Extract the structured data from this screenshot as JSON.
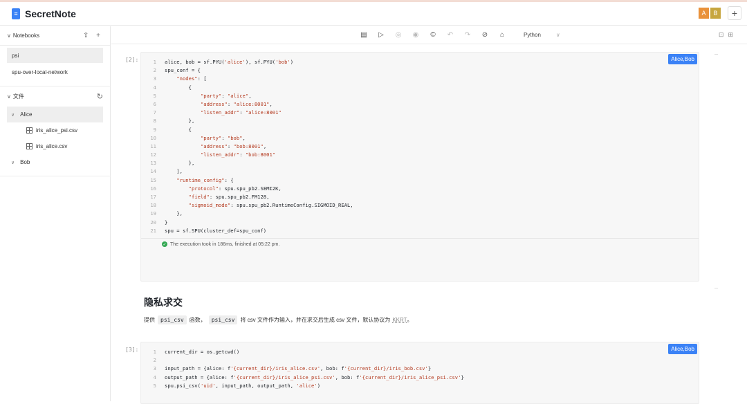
{
  "app": {
    "title": "SecretNote",
    "logo_icon": "notebook-icon"
  },
  "header": {
    "avatars": [
      "A",
      "B"
    ],
    "add_label": "+"
  },
  "sidebar": {
    "notebooks_label": "Notebooks",
    "notebook_actions": "⇪ +",
    "notebooks": [
      {
        "label": "psi",
        "active": true
      },
      {
        "label": "spu-over-local-network",
        "active": false
      }
    ],
    "files_label": "文件",
    "tree": [
      {
        "type": "folder",
        "label": "Alice",
        "selected": true
      },
      {
        "type": "file",
        "label": "iris_alice_psi.csv"
      },
      {
        "type": "file",
        "label": "iris_alice.csv"
      },
      {
        "type": "folder",
        "label": "Bob",
        "selected": false
      }
    ]
  },
  "toolbar": {
    "language": "Python"
  },
  "cells": [
    {
      "exec_count": "[2]:",
      "badge": "Alice,Bob",
      "lines": [
        "alice, bob = sf.PYU('alice'), sf.PYU('bob')",
        "spu_conf = {",
        "    \"nodes\": [",
        "        {",
        "            \"party\": \"alice\",",
        "            \"address\": \"alice:8001\",",
        "            \"listen_addr\": \"alice:8001\"",
        "        },",
        "        {",
        "            \"party\": \"bob\",",
        "            \"address\": \"bob:8001\",",
        "            \"listen_addr\": \"bob:8001\"",
        "        },",
        "    ],",
        "    \"runtime_config\": {",
        "        \"protocol\": spu.spu_pb2.SEMI2K,",
        "        \"field\": spu.spu_pb2.FM128,",
        "        \"sigmoid_mode\": spu.spu_pb2.RuntimeConfig.SIGMOID_REAL,",
        "    },",
        "}",
        "spu = sf.SPU(cluster_def=spu_conf)"
      ],
      "result": "The execution took in 186ms, finished at 05:22 pm."
    },
    {
      "exec_count": "[3]:",
      "badge": "Alice,Bob",
      "lines": [
        "current_dir = os.getcwd()",
        "",
        "input_path = {alice: f'{current_dir}/iris_alice.csv', bob: f'{current_dir}/iris_bob.csv'}",
        "output_path = {alice: f'{current_dir}/iris_alice_psi.csv', bob: f'{current_dir}/iris_alice_psi.csv'}",
        "spu.psi_csv('uid', input_path, output_path, 'alice')"
      ]
    }
  ],
  "markdown": {
    "title": "隐私求交",
    "p_prefix": "提供",
    "code1": "psi_csv",
    "p_mid1": "函数，",
    "code2": "psi_csv",
    "p_mid2": "将 csv 文件作为输入，并在求交后生成 csv 文件，默认协议为",
    "link": "KKRT",
    "p_end": "。"
  }
}
